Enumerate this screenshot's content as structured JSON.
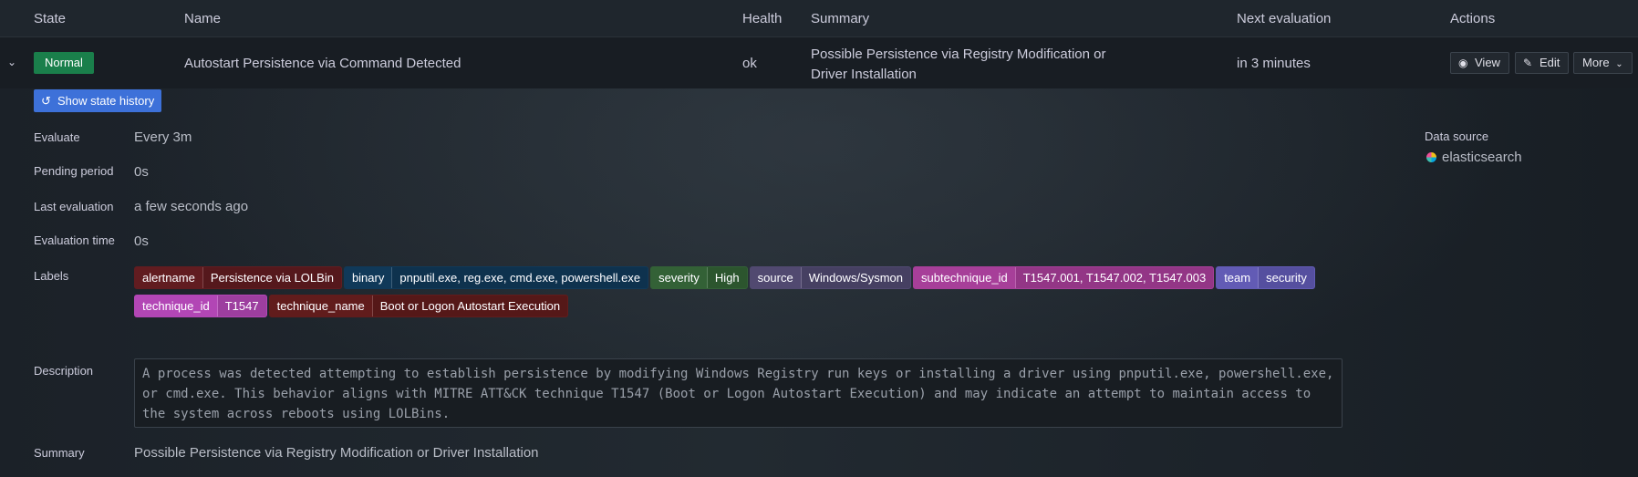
{
  "columns": {
    "state": "State",
    "name": "Name",
    "health": "Health",
    "summary": "Summary",
    "next_evaluation": "Next evaluation",
    "actions": "Actions"
  },
  "rule": {
    "state": "Normal",
    "name": "Autostart Persistence via Command Detected",
    "health": "ok",
    "summary": "Possible Persistence via Registry Modification or Driver Installation",
    "next_evaluation": "in 3 minutes",
    "actions": {
      "view": "View",
      "edit": "Edit",
      "more": "More"
    }
  },
  "details": {
    "show_state_history": "Show state history",
    "evaluate_label": "Evaluate",
    "evaluate_value": "Every 3m",
    "pending_label": "Pending period",
    "pending_value": "0s",
    "last_eval_label": "Last evaluation",
    "last_eval_value": "a few seconds ago",
    "eval_time_label": "Evaluation time",
    "eval_time_value": "0s",
    "labels_label": "Labels",
    "description_label": "Description",
    "description": "A process was detected attempting to establish persistence by modifying Windows Registry run keys or installing a driver using pnputil.exe, powershell.exe, or cmd.exe. This behavior aligns with MITRE ATT&CK technique T1547 (Boot or Logon Autostart Execution) and may indicate an attempt to maintain access to the system across reboots using LOLBins.",
    "summary_label": "Summary",
    "summary_value": "Possible Persistence via Registry Modification or Driver Installation",
    "data_source_label": "Data source",
    "data_source_value": "elasticsearch"
  },
  "labels": [
    {
      "key": "alertname",
      "value": "Persistence via LOLBin",
      "color": "#5a1a1e"
    },
    {
      "key": "binary",
      "value": "pnputil.exe, reg.exe, cmd.exe, powershell.exe",
      "color": "#0f3552"
    },
    {
      "key": "severity",
      "value": "High",
      "color": "#2f5a32"
    },
    {
      "key": "source",
      "value": "Windows/Sysmon",
      "color": "#4b4468"
    },
    {
      "key": "subtechnique_id",
      "value": "T1547.001, T1547.002, T1547.003",
      "color": "#9b3a8e"
    },
    {
      "key": "team",
      "value": "security",
      "color": "#5b54a8"
    },
    {
      "key": "technique_id",
      "value": "T1547",
      "color": "#a541a8"
    },
    {
      "key": "technique_name",
      "value": "Boot or Logon Autostart Execution",
      "color": "#5a1a1a"
    }
  ],
  "icons": {
    "expand": "chevron-down-icon",
    "history": "history-icon",
    "view": "eye-icon",
    "edit": "pencil-icon",
    "more": "chevron-down-icon",
    "datasource": "elasticsearch-icon"
  },
  "colors": {
    "state_normal": "#1a7f4b",
    "primary_button": "#3d71d9",
    "background": "#1a2026"
  }
}
